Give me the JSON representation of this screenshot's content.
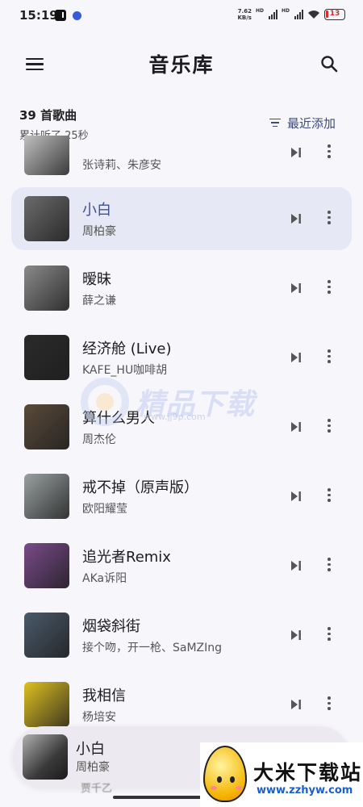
{
  "status_bar": {
    "time": "15:19",
    "net_speed_value": "7.62",
    "net_speed_unit": "KB/s",
    "hd_label": "HD",
    "battery": "13"
  },
  "app_bar": {
    "title": "音乐库",
    "menu_icon": "hamburger-menu-icon",
    "search_icon": "search-icon"
  },
  "library": {
    "song_count": "39 首歌曲",
    "listened": "累计听了 25秒",
    "sort_label": "最近添加"
  },
  "songs": [
    {
      "title": "",
      "artist": "张诗莉、朱彦安",
      "active": false,
      "cover_color": "#c9c9c9"
    },
    {
      "title": "小白",
      "artist": "周柏豪",
      "active": true,
      "cover_color": "#6b6b6b"
    },
    {
      "title": "暧昧",
      "artist": "薛之谦",
      "active": false,
      "cover_color": "#8a8a8a"
    },
    {
      "title": "经济舱 (Live)",
      "artist": "KAFE_HU咖啡胡",
      "active": false,
      "cover_color": "#2a2a2a"
    },
    {
      "title": "算什么男人",
      "artist": "周杰伦",
      "active": false,
      "cover_color": "#5a4a3a"
    },
    {
      "title": "戒不掉（原声版）",
      "artist": "欧阳耀莹",
      "active": false,
      "cover_color": "#9aa0a0"
    },
    {
      "title": "追光者Remix",
      "artist": "AKa诉阳",
      "active": false,
      "cover_color": "#7a4a8a"
    },
    {
      "title": "烟袋斜街",
      "artist": "接个吻，开一枪、SaMZIng",
      "active": false,
      "cover_color": "#4a5a6a"
    },
    {
      "title": "我相信",
      "artist": "杨培安",
      "active": false,
      "cover_color": "#e0c020"
    }
  ],
  "mini_player": {
    "title": "小白",
    "artist": "周柏豪",
    "peek_artist": "贾千乙"
  },
  "watermark": {
    "text": "精品下载",
    "url": "www.jj9p.com"
  },
  "corner_logo": {
    "title": "大米下载站",
    "url": "www.zzhyw.com"
  }
}
